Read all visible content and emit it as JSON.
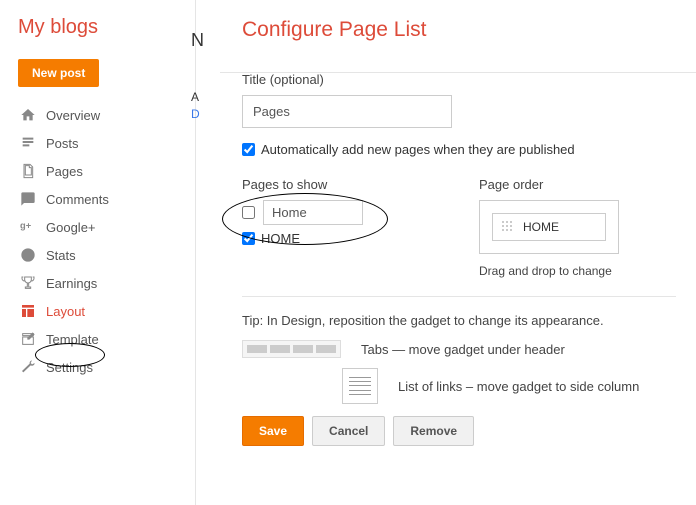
{
  "sidebar": {
    "heading": "My blogs",
    "new_post": "New post",
    "items": [
      {
        "label": "Overview"
      },
      {
        "label": "Posts"
      },
      {
        "label": "Pages"
      },
      {
        "label": "Comments"
      },
      {
        "label": "Google+"
      },
      {
        "label": "Stats"
      },
      {
        "label": "Earnings"
      },
      {
        "label": "Layout"
      },
      {
        "label": "Template"
      },
      {
        "label": "Settings"
      }
    ]
  },
  "main": {
    "title": "Configure Page List",
    "title_field_label": "Title (optional)",
    "title_value": "Pages",
    "auto_add_label": "Automatically add new pages when they are published",
    "pages_to_show_label": "Pages to show",
    "page_order_label": "Page order",
    "page_home": "Home",
    "page_home_caps": "HOME",
    "order_item": "HOME",
    "drag_text": "Drag and drop to change",
    "tip": "Tip: In Design, reposition the gadget to change its appearance.",
    "tabs_text": "Tabs — move gadget under header",
    "list_text": "List of links – move gadget to side column",
    "save": "Save",
    "cancel": "Cancel",
    "remove": "Remove"
  },
  "clipped": {
    "n": "N",
    "a": "A",
    "d": "D"
  }
}
